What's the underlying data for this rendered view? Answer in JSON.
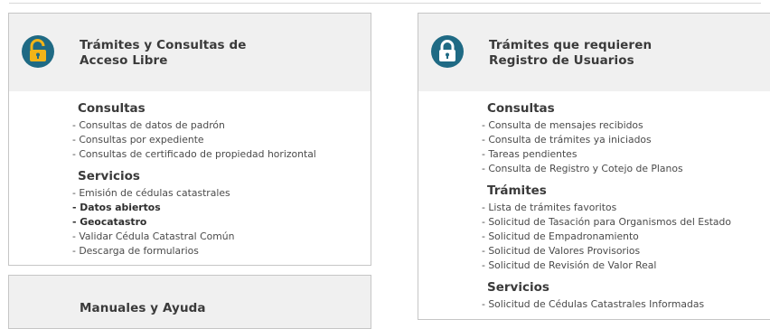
{
  "left_panel": {
    "title_line1": "Trámites y Consultas de",
    "title_line2": "Acceso Libre",
    "icon": "unlocked-padlock-icon",
    "consultas": {
      "title": "Consultas",
      "items": [
        "- Consultas de datos de padrón",
        "- Consultas por expediente",
        "- Consultas de certificado de propiedad horizontal"
      ]
    },
    "servicios": {
      "title": "Servicios",
      "items": [
        "- Emisión de cédulas catastrales",
        "- Datos abiertos",
        "- Geocatastro",
        "- Validar Cédula Catastral Común",
        "- Descarga de formularios"
      ]
    }
  },
  "left_bottom_panel": {
    "title_partial": "Manuales y Ayuda"
  },
  "right_panel": {
    "title_line1": "Trámites que requieren",
    "title_line2": "Registro de Usuarios",
    "icon": "locked-padlock-icon",
    "consultas": {
      "title": "Consultas",
      "items": [
        "- Consulta de mensajes recibidos",
        "- Consulta de trámites ya iniciados",
        "- Tareas pendientes",
        "- Consulta de Registro y Cotejo de Planos"
      ]
    },
    "tramites": {
      "title": "Trámites",
      "items": [
        "- Lista de trámites favoritos",
        "- Solicitud de Tasación para Organismos del Estado",
        "- Solicitud de Empadronamiento",
        "- Solicitud de Valores Provisorios",
        "- Solicitud de Revisión de Valor Real"
      ]
    },
    "servicios": {
      "title": "Servicios",
      "items": [
        "- Solicitud de Cédulas Catastrales Informadas"
      ]
    }
  },
  "colors": {
    "icon_bg": "#1f6a84",
    "padlock": "#f2b418",
    "header_bg": "#f0f0f0",
    "border": "#c6c6c6"
  }
}
